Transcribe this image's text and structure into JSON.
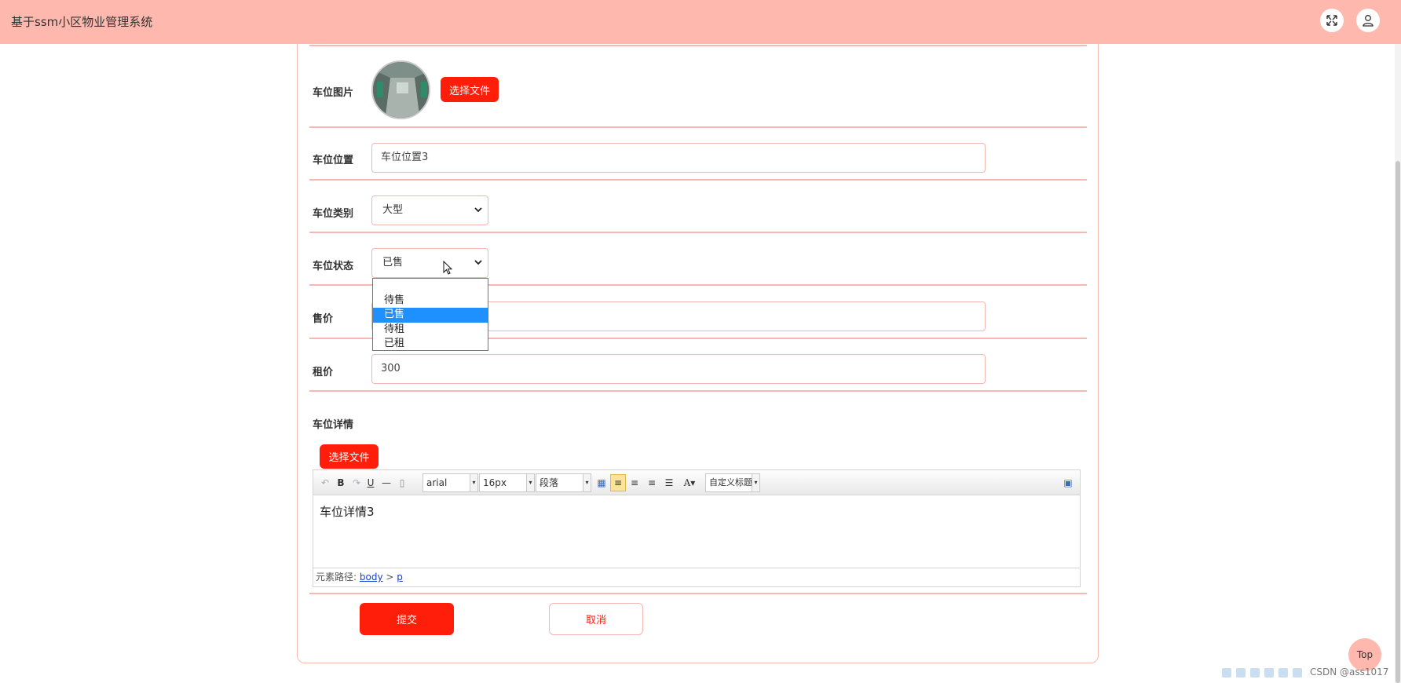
{
  "header": {
    "title": "基于ssm小区物业管理系统",
    "fullscreen_icon": "expand-icon",
    "user_icon": "user-icon"
  },
  "form": {
    "image": {
      "label": "车位图片",
      "upload_label": "选择文件"
    },
    "location": {
      "label": "车位位置",
      "value": "车位位置3"
    },
    "category": {
      "label": "车位类别",
      "value": "大型"
    },
    "status": {
      "label": "车位状态",
      "value": "已售",
      "options": [
        "",
        "待售",
        "已售",
        "待租",
        "已租"
      ],
      "selected_option": "已售"
    },
    "sale_price": {
      "label": "售价",
      "value": ""
    },
    "rent_price": {
      "label": "租价",
      "value": "300"
    },
    "detail": {
      "label": "车位详情",
      "upload_label": "选择文件",
      "toolbar": {
        "font_family": "arial",
        "font_size": "16px",
        "paragraph": "段落",
        "custom_heading": "自定义标题"
      },
      "content": "车位详情3",
      "path_label": "元素路径:",
      "path_body": "body",
      "path_sep": ">",
      "path_p": "p"
    },
    "submit_label": "提交",
    "cancel_label": "取消"
  },
  "back_to_top": "Top",
  "watermark": "CSDN @ass1017",
  "colors": {
    "header_bg": "#ffb8ae",
    "primary": "#ff1e0a",
    "border": "#f6b8b0",
    "selected_option": "#1e90ff"
  }
}
